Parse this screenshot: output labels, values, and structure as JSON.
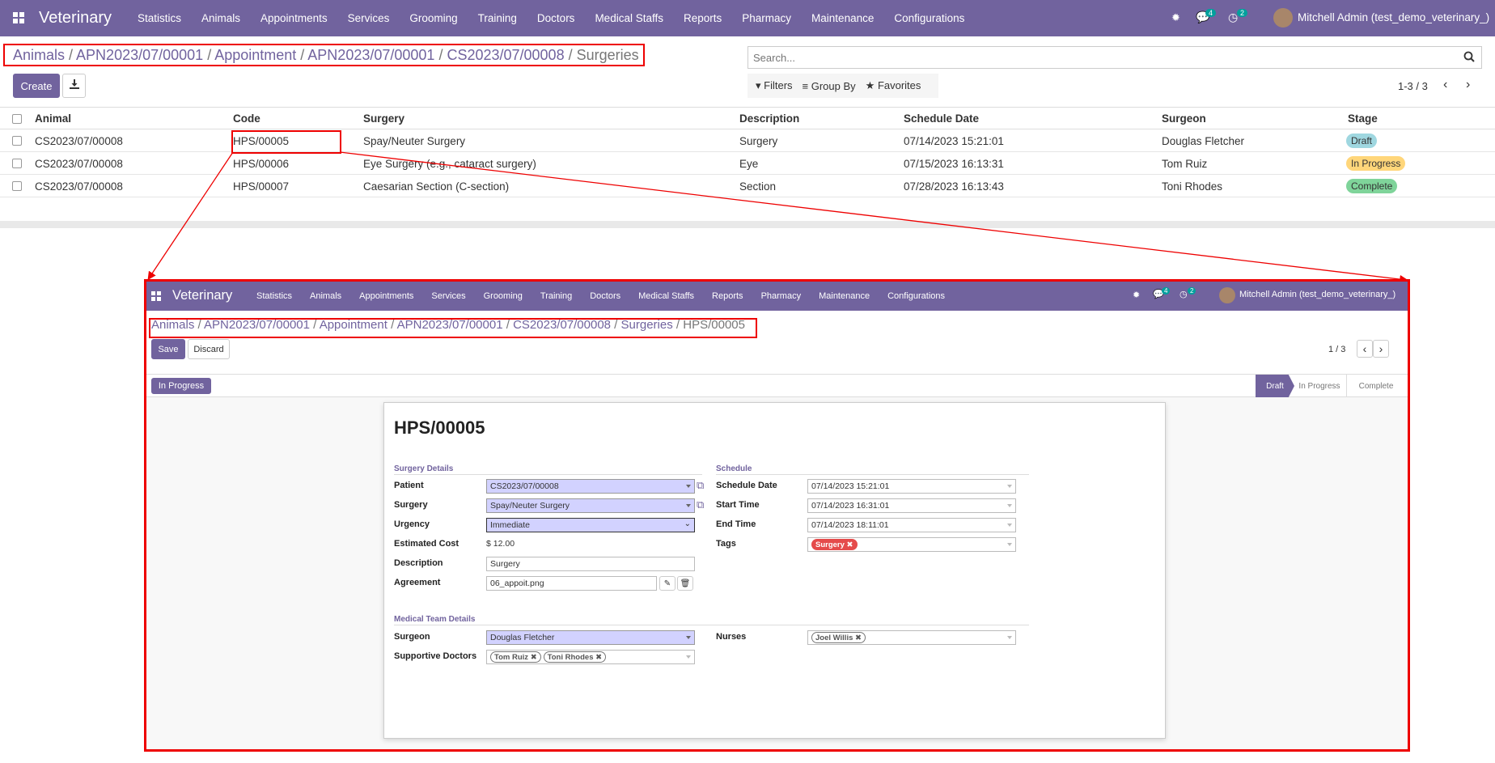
{
  "app": {
    "name": "Veterinary",
    "menu": [
      "Statistics",
      "Animals",
      "Appointments",
      "Services",
      "Grooming",
      "Training",
      "Doctors",
      "Medical Staffs",
      "Reports",
      "Pharmacy",
      "Maintenance",
      "Configurations"
    ],
    "user": "Mitchell Admin (test_demo_veterinary_)",
    "messages_count": "4",
    "activities_count": "2"
  },
  "list": {
    "breadcrumb": [
      "Animals",
      "APN2023/07/00001",
      "Appointment",
      "APN2023/07/00001",
      "CS2023/07/00008"
    ],
    "breadcrumb_active": "Surgeries",
    "create_label": "Create",
    "search_placeholder": "Search...",
    "filters_label": "Filters",
    "groupby_label": "Group By",
    "favorites_label": "Favorites",
    "pager": "1-3 / 3",
    "columns": [
      "Animal",
      "Code",
      "Surgery",
      "Description",
      "Schedule Date",
      "Surgeon",
      "Stage"
    ],
    "rows": [
      {
        "animal": "CS2023/07/00008",
        "code": "HPS/00005",
        "surgery": "Spay/Neuter Surgery",
        "description": "Surgery",
        "date": "07/14/2023 15:21:01",
        "surgeon": "Douglas Fletcher",
        "stage": "Draft"
      },
      {
        "animal": "CS2023/07/00008",
        "code": "HPS/00006",
        "surgery": "Eye Surgery (e.g., cataract surgery)",
        "description": "Eye",
        "date": "07/15/2023 16:13:31",
        "surgeon": "Tom Ruiz",
        "stage": "In Progress"
      },
      {
        "animal": "CS2023/07/00008",
        "code": "HPS/00007",
        "surgery": "Caesarian Section (C-section)",
        "description": "Section",
        "date": "07/28/2023 16:13:43",
        "surgeon": "Toni Rhodes",
        "stage": "Complete"
      }
    ],
    "stage_colors": {
      "Draft": "#9fd7e0",
      "In Progress": "#ffd67a",
      "Complete": "#7fd49a"
    }
  },
  "form": {
    "breadcrumb": [
      "Animals",
      "APN2023/07/00001",
      "Appointment",
      "APN2023/07/00001",
      "CS2023/07/00008",
      "Surgeries"
    ],
    "breadcrumb_active": "HPS/00005",
    "save_label": "Save",
    "discard_label": "Discard",
    "pager": "1 / 3",
    "status_button": "In Progress",
    "stages": [
      "Draft",
      "In Progress",
      "Complete"
    ],
    "title": "HPS/00005",
    "surgery_details_heading": "Surgery Details",
    "schedule_heading": "Schedule",
    "medical_team_heading": "Medical Team Details",
    "labels": {
      "patient": "Patient",
      "surgery": "Surgery",
      "urgency": "Urgency",
      "cost": "Estimated Cost",
      "description": "Description",
      "agreement": "Agreement",
      "schedule_date": "Schedule Date",
      "start_time": "Start Time",
      "end_time": "End Time",
      "tags": "Tags",
      "surgeon": "Surgeon",
      "supportive": "Supportive Doctors",
      "nurses": "Nurses"
    },
    "values": {
      "patient": "CS2023/07/00008",
      "surgery": "Spay/Neuter Surgery",
      "urgency": "Immediate",
      "cost": "$ 12.00",
      "description": "Surgery",
      "agreement": "06_appoit.png",
      "schedule_date": "07/14/2023 15:21:01",
      "start_time": "07/14/2023 16:31:01",
      "end_time": "07/14/2023 18:11:01",
      "tag": "Surgery",
      "surgeon": "Douglas Fletcher",
      "supportive": [
        "Tom Ruiz",
        "Toni Rhodes"
      ],
      "nurse": "Joel Willis"
    }
  }
}
